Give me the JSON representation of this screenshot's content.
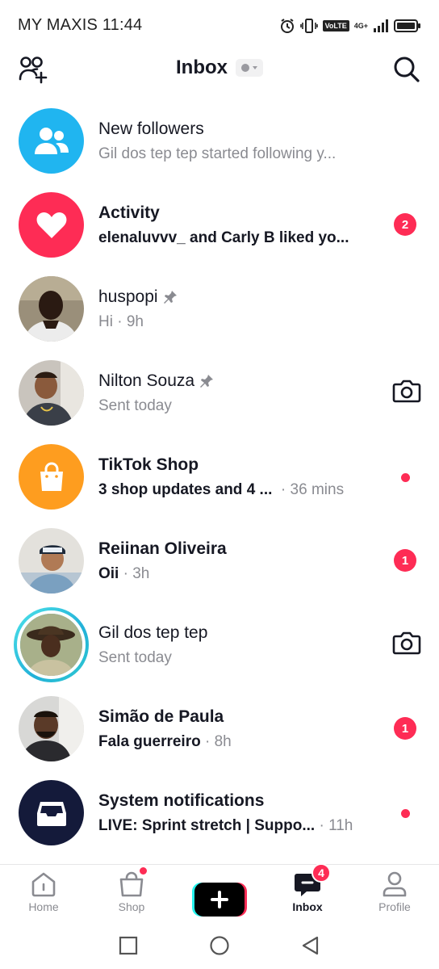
{
  "status_bar": {
    "carrier": "MY MAXIS",
    "time": "11:44",
    "volte": "VoLTE",
    "network": "4G+"
  },
  "header": {
    "title": "Inbox",
    "left_icon": "add-friends-icon",
    "right_icon": "search-icon"
  },
  "rows": [
    {
      "title": "New followers",
      "subtitle": "Gil dos tep tep started following y...",
      "icon": "followers-icon",
      "color": "#20b5f0"
    },
    {
      "title": "Activity",
      "subtitle": "elenaluvvv_ and Carly B liked yo...",
      "badge": "2",
      "icon": "heart-icon",
      "color": "#fe2c55"
    },
    {
      "title": "huspopi",
      "subtitle": "Hi",
      "time": "9h",
      "pinned": true
    },
    {
      "title": "Nilton Souza",
      "subtitle": "Sent today",
      "pinned": true,
      "action_icon": "camera-icon"
    },
    {
      "title": "TikTok Shop",
      "subtitle": "3 shop updates and 4 ...",
      "time": "36 mins",
      "icon": "shopping-bag-icon",
      "color": "#fe9d1f"
    },
    {
      "title": "Reiinan Oliveira",
      "subtitle": "Oii",
      "time": "3h",
      "badge": "1"
    },
    {
      "title": "Gil dos tep tep",
      "subtitle": "Sent today",
      "action_icon": "camera-icon"
    },
    {
      "title": "Simão de Paula",
      "subtitle": "Fala guerreiro",
      "time": "8h",
      "badge": "1"
    },
    {
      "title": "System notifications",
      "subtitle": "LIVE: Sprint stretch | Suppo...",
      "time": "11h",
      "icon": "inbox-tray-icon",
      "color": "#141a3a"
    }
  ],
  "bottom_nav": {
    "home": "Home",
    "shop": "Shop",
    "inbox": "Inbox",
    "inbox_badge": "4",
    "profile": "Profile"
  },
  "colors": {
    "accent": "#fe2c55",
    "text_primary": "#161823",
    "text_secondary": "#8a8b91"
  }
}
